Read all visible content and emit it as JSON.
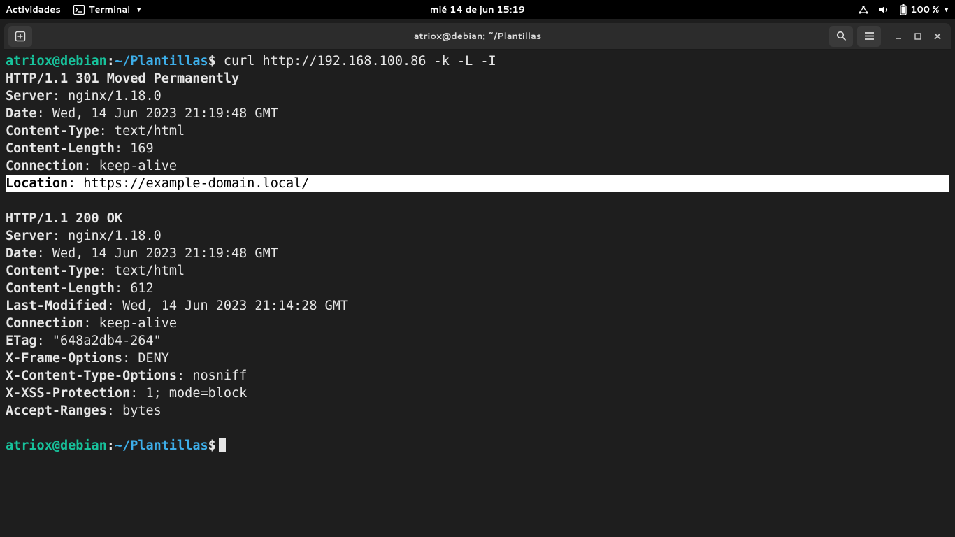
{
  "topbar": {
    "activities": "Actividades",
    "app_name": "Terminal",
    "clock": "mié 14 de jun  15:19",
    "battery": "100 %"
  },
  "window": {
    "title": "atriox@debian: ~/Plantillas"
  },
  "prompt": {
    "user_host": "atriox@debian",
    "sep": ":",
    "path": "~/Plantillas",
    "dollar": "$"
  },
  "command": " curl http://192.168.100.86 -k -L -I",
  "resp1": {
    "status": "HTTP/1.1 301 Moved Permanently",
    "server_k": "Server",
    "server_v": ": nginx/1.18.0",
    "date_k": "Date",
    "date_v": ": Wed, 14 Jun 2023 21:19:48 GMT",
    "ctype_k": "Content-Type",
    "ctype_v": ": text/html",
    "clen_k": "Content-Length",
    "clen_v": ": 169",
    "conn_k": "Connection",
    "conn_v": ": keep-alive",
    "loc_k": "Location",
    "loc_v": ": https://example-domain.local/"
  },
  "resp2": {
    "status": "HTTP/1.1 200 OK",
    "server_k": "Server",
    "server_v": ": nginx/1.18.0",
    "date_k": "Date",
    "date_v": ": Wed, 14 Jun 2023 21:19:48 GMT",
    "ctype_k": "Content-Type",
    "ctype_v": ": text/html",
    "clen_k": "Content-Length",
    "clen_v": ": 612",
    "lmod_k": "Last-Modified",
    "lmod_v": ": Wed, 14 Jun 2023 21:14:28 GMT",
    "conn_k": "Connection",
    "conn_v": ": keep-alive",
    "etag_k": "ETag",
    "etag_v": ": \"648a2db4-264\"",
    "xfo_k": "X-Frame-Options",
    "xfo_v": ": DENY",
    "xcto_k": "X-Content-Type-Options",
    "xcto_v": ": nosniff",
    "xxss_k": "X-XSS-Protection",
    "xxss_v": ": 1; mode=block",
    "arng_k": "Accept-Ranges",
    "arng_v": ": bytes"
  }
}
